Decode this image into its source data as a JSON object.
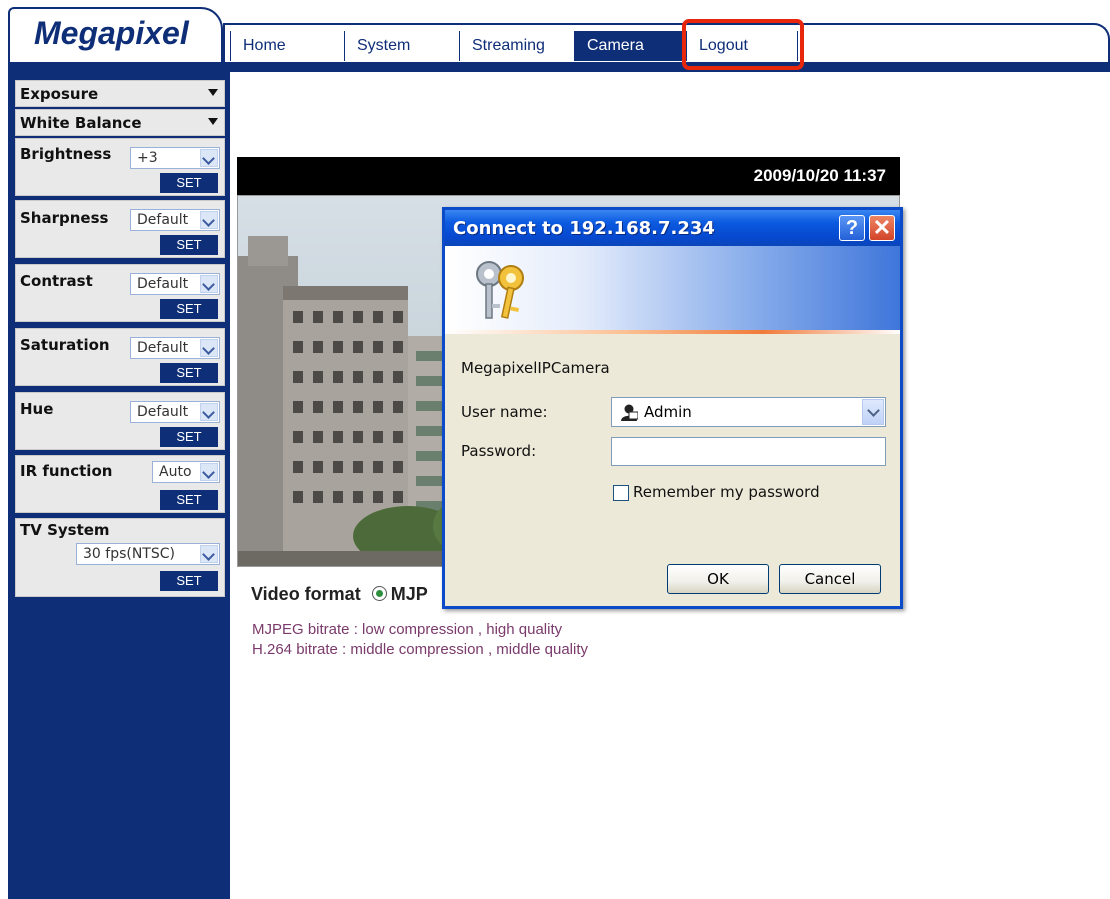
{
  "brand": {
    "logo_text": "Megapixel"
  },
  "nav": {
    "tabs": [
      {
        "label": "Home"
      },
      {
        "label": "System"
      },
      {
        "label": "Streaming"
      },
      {
        "label": "Camera"
      },
      {
        "label": "Logout"
      }
    ],
    "active_tab": "Camera",
    "highlight_tab": "Logout",
    "highlight_color": "#e8260c"
  },
  "sidebar": {
    "exposure_label": "Exposure",
    "white_balance_label": "White Balance",
    "set_label": "SET",
    "settings": {
      "brightness": {
        "label": "Brightness",
        "value": "+3"
      },
      "sharpness": {
        "label": "Sharpness",
        "value": "Default"
      },
      "contrast": {
        "label": "Contrast",
        "value": "Default"
      },
      "saturation": {
        "label": "Saturation",
        "value": "Default"
      },
      "hue": {
        "label": "Hue",
        "value": "Default"
      },
      "ir_function": {
        "label": "IR function",
        "value": "Auto"
      },
      "tv_system": {
        "label": "TV System",
        "value": "30 fps(NTSC)"
      }
    }
  },
  "video": {
    "timestamp": "2009/10/20 11:37",
    "format_label": "Video format",
    "format_selected": "MJP",
    "bitrate_lines": [
      "MJPEG bitrate : low compression , high quality",
      "H.264 bitrate : middle compression , middle quality"
    ]
  },
  "dialog": {
    "title": "Connect to 192.168.7.234",
    "help_glyph": "?",
    "close_glyph": "✕",
    "realm": "MegapixelIPCamera",
    "username_label": "User name:",
    "username_value": "Admin",
    "password_label": "Password:",
    "password_value": "",
    "remember_label": "Remember my password",
    "remember_checked": false,
    "ok_label": "OK",
    "cancel_label": "Cancel"
  },
  "colors": {
    "brand_navy": "#0e2e78",
    "dialog_blue": "#0b4ac8",
    "bitrate_text": "#7a3a6b"
  },
  "icons": [
    "keys-icon",
    "user-icon",
    "help-icon",
    "close-icon",
    "chevron-down-icon",
    "radio-selected-icon"
  ]
}
